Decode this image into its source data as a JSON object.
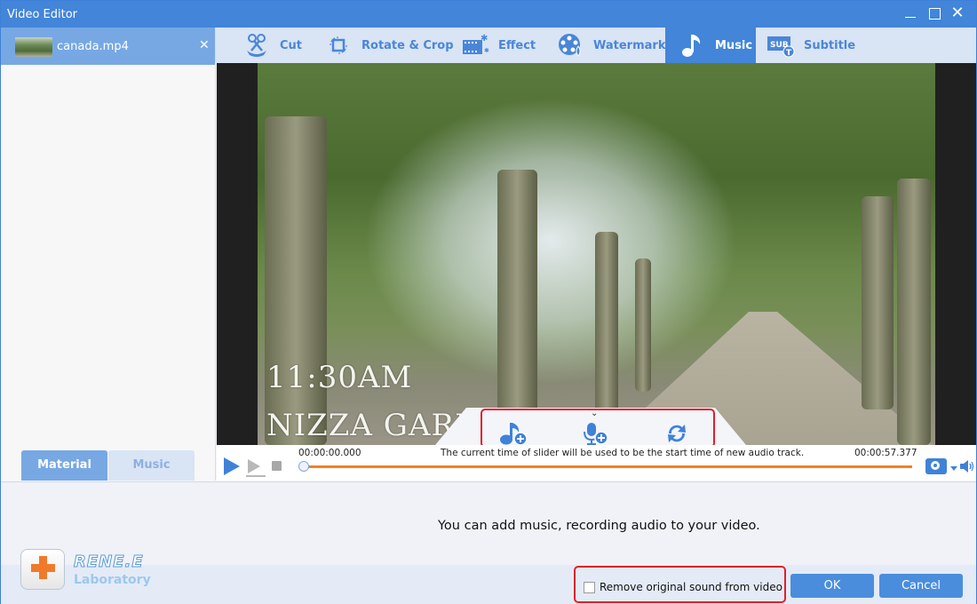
{
  "window": {
    "title": "Video Editor",
    "close_glyph": "✕"
  },
  "sidebar": {
    "file": {
      "name": "canada.mp4",
      "remove_glyph": "✕"
    },
    "tabs": [
      {
        "label": "Material",
        "active": true
      },
      {
        "label": "Music",
        "active": false
      }
    ]
  },
  "toolbar": {
    "tabs": [
      {
        "label": "Cut",
        "icon": "scissors-icon",
        "active": false
      },
      {
        "label": "Rotate & Crop",
        "icon": "rotate-crop-icon",
        "active": false
      },
      {
        "label": "Effect",
        "icon": "film-effect-icon",
        "active": false
      },
      {
        "label": "Watermark",
        "icon": "watermark-reel-icon",
        "active": false
      },
      {
        "label": "Music",
        "icon": "music-note-icon",
        "active": true
      },
      {
        "label": "Subtitle",
        "icon": "subtitle-icon",
        "active": false
      }
    ]
  },
  "video": {
    "overlay_line1": "11:30AM",
    "overlay_line2": "NIZZA GARD"
  },
  "music_actions": [
    {
      "name": "add-music",
      "icon": "music-add-icon"
    },
    {
      "name": "add-recording",
      "icon": "microphone-add-icon"
    },
    {
      "name": "replace-audio",
      "icon": "refresh-icon"
    }
  ],
  "playback": {
    "current_time": "00:00:00.000",
    "end_time": "00:00:57.377",
    "hint": "The current time of slider will be used to be the start time of new audio track.",
    "progress": 0
  },
  "info": {
    "message": "You can add music, recording audio to your video."
  },
  "footer": {
    "brand_name": "RENE.E",
    "brand_sub": "Laboratory",
    "remove_sound_label": "Remove original sound from video",
    "remove_sound_checked": false,
    "ok_label": "OK",
    "cancel_label": "Cancel"
  },
  "colors": {
    "accent": "#4285d9",
    "tab_bar": "#d9e4f4",
    "progress": "#f08224",
    "highlight_box": "#e0202a"
  }
}
